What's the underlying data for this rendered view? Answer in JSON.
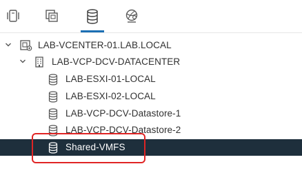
{
  "tabs": [
    {
      "name": "hosts-and-clusters",
      "icon": "hosts-clusters-icon"
    },
    {
      "name": "vms-and-templates",
      "icon": "vms-templates-icon"
    },
    {
      "name": "storage",
      "icon": "storage-icon",
      "selected": true
    },
    {
      "name": "networking",
      "icon": "network-icon"
    }
  ],
  "tree": {
    "vcenter": {
      "label": "LAB-VCENTER-01.LAB.LOCAL",
      "icon": "vcenter-icon",
      "expanded": true
    },
    "datacenter": {
      "label": "LAB-VCP-DCV-DATACENTER",
      "icon": "datacenter-icon",
      "expanded": true
    },
    "datastores": [
      {
        "label": "LAB-ESXI-01-LOCAL",
        "icon": "datastore-icon"
      },
      {
        "label": "LAB-ESXI-02-LOCAL",
        "icon": "datastore-icon"
      },
      {
        "label": "LAB-VCP-DCV-Datastore-1",
        "icon": "datastore-icon"
      },
      {
        "label": "LAB-VCP-DCV-Datastore-2",
        "icon": "datastore-icon"
      },
      {
        "label": "Shared-VMFS",
        "icon": "datastore-icon",
        "selected": true
      }
    ]
  },
  "colors": {
    "accent": "#1b6fb4",
    "selected_bg": "#1e2f3c",
    "highlight": "#e02424"
  }
}
